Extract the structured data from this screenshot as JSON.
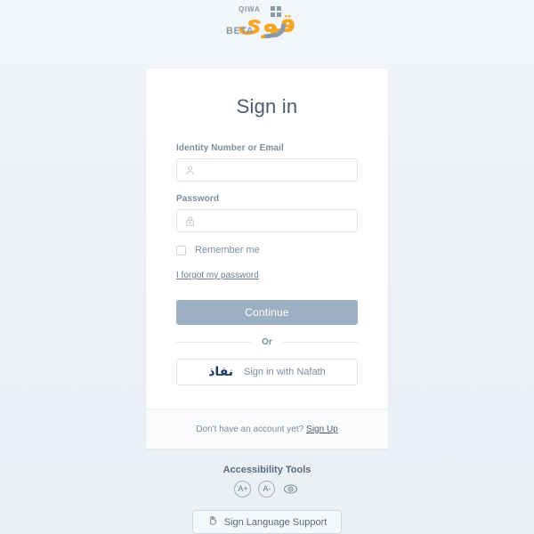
{
  "brand": {
    "name": "QIWA",
    "arabic_wordmark": "قوى",
    "beta_label": "BETA"
  },
  "card": {
    "title": "Sign in",
    "fields": [
      {
        "label": "Identity Number or Email",
        "value": "",
        "placeholder": "",
        "icon": "user-icon"
      },
      {
        "label": "Password",
        "value": "",
        "placeholder": "",
        "icon": "lock-icon"
      }
    ],
    "remember_me": {
      "label": "Remember me",
      "checked": false
    },
    "forgot_password_link": "I forgot my password",
    "continue_button": "Continue",
    "divider_text": "Or",
    "nafath_button": {
      "logo_text": "نفاذ",
      "label": "Sign in with Nafath"
    },
    "footer": {
      "prompt": "Don't have an account yet?",
      "signup_link": "Sign Up"
    }
  },
  "accessibility": {
    "title": "Accessibility Tools",
    "tools": [
      {
        "label": "A+",
        "name": "increase-font-size"
      },
      {
        "label": "A-",
        "name": "decrease-font-size"
      },
      {
        "label": "",
        "name": "contrast-eye"
      }
    ],
    "sign_language_button": "Sign Language Support"
  },
  "colors": {
    "page_background": "#eef2f6",
    "card_background": "#ffffff",
    "brand_orange": "#f5a623",
    "primary_button": "#9dafc3",
    "text_muted": "#7d8c9c",
    "text_dark": "#4c5c6e",
    "nafath_navy": "#1f3864"
  }
}
